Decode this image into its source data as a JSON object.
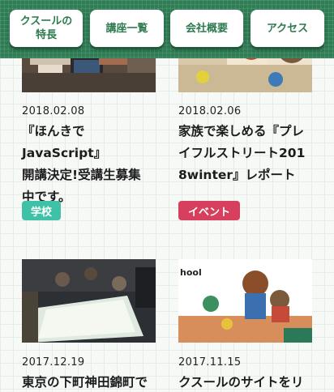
{
  "nav": {
    "items": [
      {
        "label": "クスールの\n特長"
      },
      {
        "label": "講座一覧"
      },
      {
        "label": "会社概要"
      },
      {
        "label": "アクセス"
      }
    ]
  },
  "posts": [
    {
      "date": "2018.02.08",
      "title": "『ほんきでJavaScript』\n開講決定!受講生募集\n中です。",
      "tag": "学校",
      "tag_color": "#3ec1a7"
    },
    {
      "date": "2018.02.06",
      "title": "家族で楽しめる『プレ\nイフルストリート201\n8winter』レポート",
      "tag": "イベント",
      "tag_color": "#d6405e"
    },
    {
      "date": "2017.12.19",
      "title": "東京の下町神田錦町で"
    },
    {
      "date": "2017.11.15",
      "title": "クスールのサイトをリ"
    }
  ],
  "colors": {
    "nav_green": "#2f7d55",
    "nav_text": "#2d7a4f",
    "school_tag": "#3ec1a7",
    "event_tag": "#d6405e"
  },
  "logo_text": "hool"
}
